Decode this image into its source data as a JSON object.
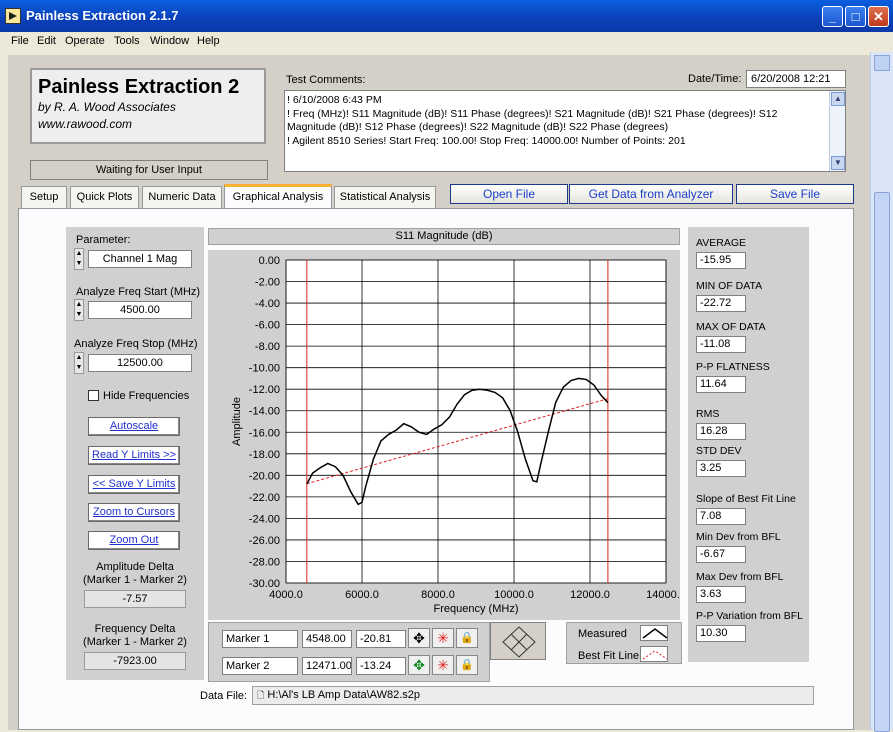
{
  "window": {
    "title": "Painless Extraction 2.1.7"
  },
  "menu": [
    "File",
    "Edit",
    "Operate",
    "Tools",
    "Window",
    "Help"
  ],
  "brand": {
    "title": "Painless Extraction 2",
    "by": "by R. A. Wood Associates",
    "url": "www.rawood.com"
  },
  "status": "Waiting for User Input",
  "comments": {
    "label": "Test Comments:",
    "datetime_label": "Date/Time:",
    "datetime": "6/20/2008  12:21",
    "lines": [
      "! 6/10/2008 6:43 PM",
      "! Freq (MHz)! S11 Magnitude (dB)! S11 Phase (degrees)! S21 Magnitude (dB)! S21 Phase (degrees)! S12",
      "Magnitude (dB)! S12 Phase (degrees)! S22 Magnitude (dB)! S22 Phase (degrees)",
      "! Agilent 8510 Series! Start Freq: 100.00! Stop Freq: 14000.00! Number of Points: 201"
    ]
  },
  "tabs": [
    "Setup",
    "Quick Plots",
    "Numeric Data",
    "Graphical Analysis",
    "Statistical Analysis"
  ],
  "actions": {
    "open": "Open File",
    "get": "Get Data from Analyzer",
    "save": "Save File"
  },
  "left": {
    "parameter_label": "Parameter:",
    "parameter": "Channel 1 Mag",
    "start_label": "Analyze Freq Start (MHz)",
    "start": "4500.00",
    "stop_label": "Analyze Freq Stop (MHz)",
    "stop": "12500.00",
    "hide_freq": "Hide Frequencies",
    "btn_autoscale": "Autoscale",
    "btn_read": "Read Y Limits >>",
    "btn_save": "<< Save Y Limits",
    "btn_zoom_cursors": "Zoom to Cursors",
    "btn_zoom_out": "Zoom Out",
    "amp_delta_label1": "Amplitude Delta",
    "amp_delta_label2": "(Marker 1 - Marker 2)",
    "amp_delta": "-7.57",
    "freq_delta_label1": "Frequency Delta",
    "freq_delta_label2": "(Marker 1 - Marker 2)",
    "freq_delta": "-7923.00"
  },
  "markers": [
    {
      "name": "Marker 1",
      "freq": "4548.00",
      "amp": "-20.81"
    },
    {
      "name": "Marker 2",
      "freq": "12471.00",
      "amp": "-13.24"
    }
  ],
  "legend": {
    "measured": "Measured",
    "bfl": "Best Fit Line"
  },
  "stats": [
    {
      "label": "AVERAGE",
      "value": "-15.95"
    },
    {
      "label": "MIN OF DATA",
      "value": "-22.72"
    },
    {
      "label": "MAX OF DATA",
      "value": "-11.08"
    },
    {
      "label": "P-P FLATNESS",
      "value": "11.64"
    },
    {
      "label": "RMS",
      "value": "16.28"
    },
    {
      "label": "STD DEV",
      "value": "3.25"
    },
    {
      "label": "Slope of Best Fit Line",
      "value": "7.08"
    },
    {
      "label": "Min Dev from BFL",
      "value": "-6.67"
    },
    {
      "label": "Max Dev from BFL",
      "value": "3.63"
    },
    {
      "label": "P-P Variation from BFL",
      "value": "10.30"
    }
  ],
  "datafile": {
    "label": "Data File:",
    "path": "H:\\Al's LB Amp Data\\AW82.s2p"
  },
  "colors": {
    "measured": "#000000",
    "bfl": "#e02020",
    "cursor": "#e02020",
    "plot_bg": "#ffffff"
  },
  "chart_data": {
    "type": "line",
    "title": "S11 Magnitude (dB)",
    "xlabel": "Frequency (MHz)",
    "ylabel": "Amplitude",
    "xlim": [
      4000,
      14000
    ],
    "ylim": [
      -30,
      0
    ],
    "x_ticks": [
      "4000.0",
      "6000.0",
      "8000.0",
      "10000.0",
      "12000.0",
      "14000.0"
    ],
    "y_ticks": [
      "0.00",
      "-2.00",
      "-4.00",
      "-6.00",
      "-8.00",
      "-10.00",
      "-12.00",
      "-14.00",
      "-16.00",
      "-18.00",
      "-20.00",
      "-22.00",
      "-24.00",
      "-26.00",
      "-28.00",
      "-30.00"
    ],
    "grid": true,
    "cursors_x": [
      4548,
      12471
    ],
    "series": [
      {
        "name": "Measured",
        "x": [
          4548,
          4700,
          4900,
          5100,
          5300,
          5500,
          5700,
          5900,
          6000,
          6100,
          6300,
          6500,
          6700,
          6900,
          7100,
          7300,
          7500,
          7700,
          7900,
          8100,
          8300,
          8500,
          8700,
          8900,
          9100,
          9300,
          9500,
          9700,
          9900,
          10100,
          10300,
          10500,
          10600,
          10700,
          10900,
          11100,
          11300,
          11500,
          11700,
          11900,
          12100,
          12300,
          12471
        ],
        "y": [
          -20.81,
          -19.8,
          -19.3,
          -18.9,
          -19.2,
          -20.0,
          -21.5,
          -22.7,
          -22.5,
          -21.0,
          -18.5,
          -16.8,
          -16.2,
          -15.8,
          -15.2,
          -15.5,
          -16.0,
          -16.2,
          -15.7,
          -15.3,
          -14.6,
          -13.4,
          -12.5,
          -12.1,
          -12.0,
          -12.1,
          -12.3,
          -12.8,
          -14.0,
          -16.0,
          -18.5,
          -20.5,
          -20.6,
          -19.0,
          -16.0,
          -13.2,
          -11.8,
          -11.2,
          -11.0,
          -11.1,
          -11.6,
          -12.6,
          -13.24
        ]
      },
      {
        "name": "Best Fit Line",
        "x": [
          4548,
          12471
        ],
        "y": [
          -20.78,
          -12.88
        ]
      }
    ]
  }
}
